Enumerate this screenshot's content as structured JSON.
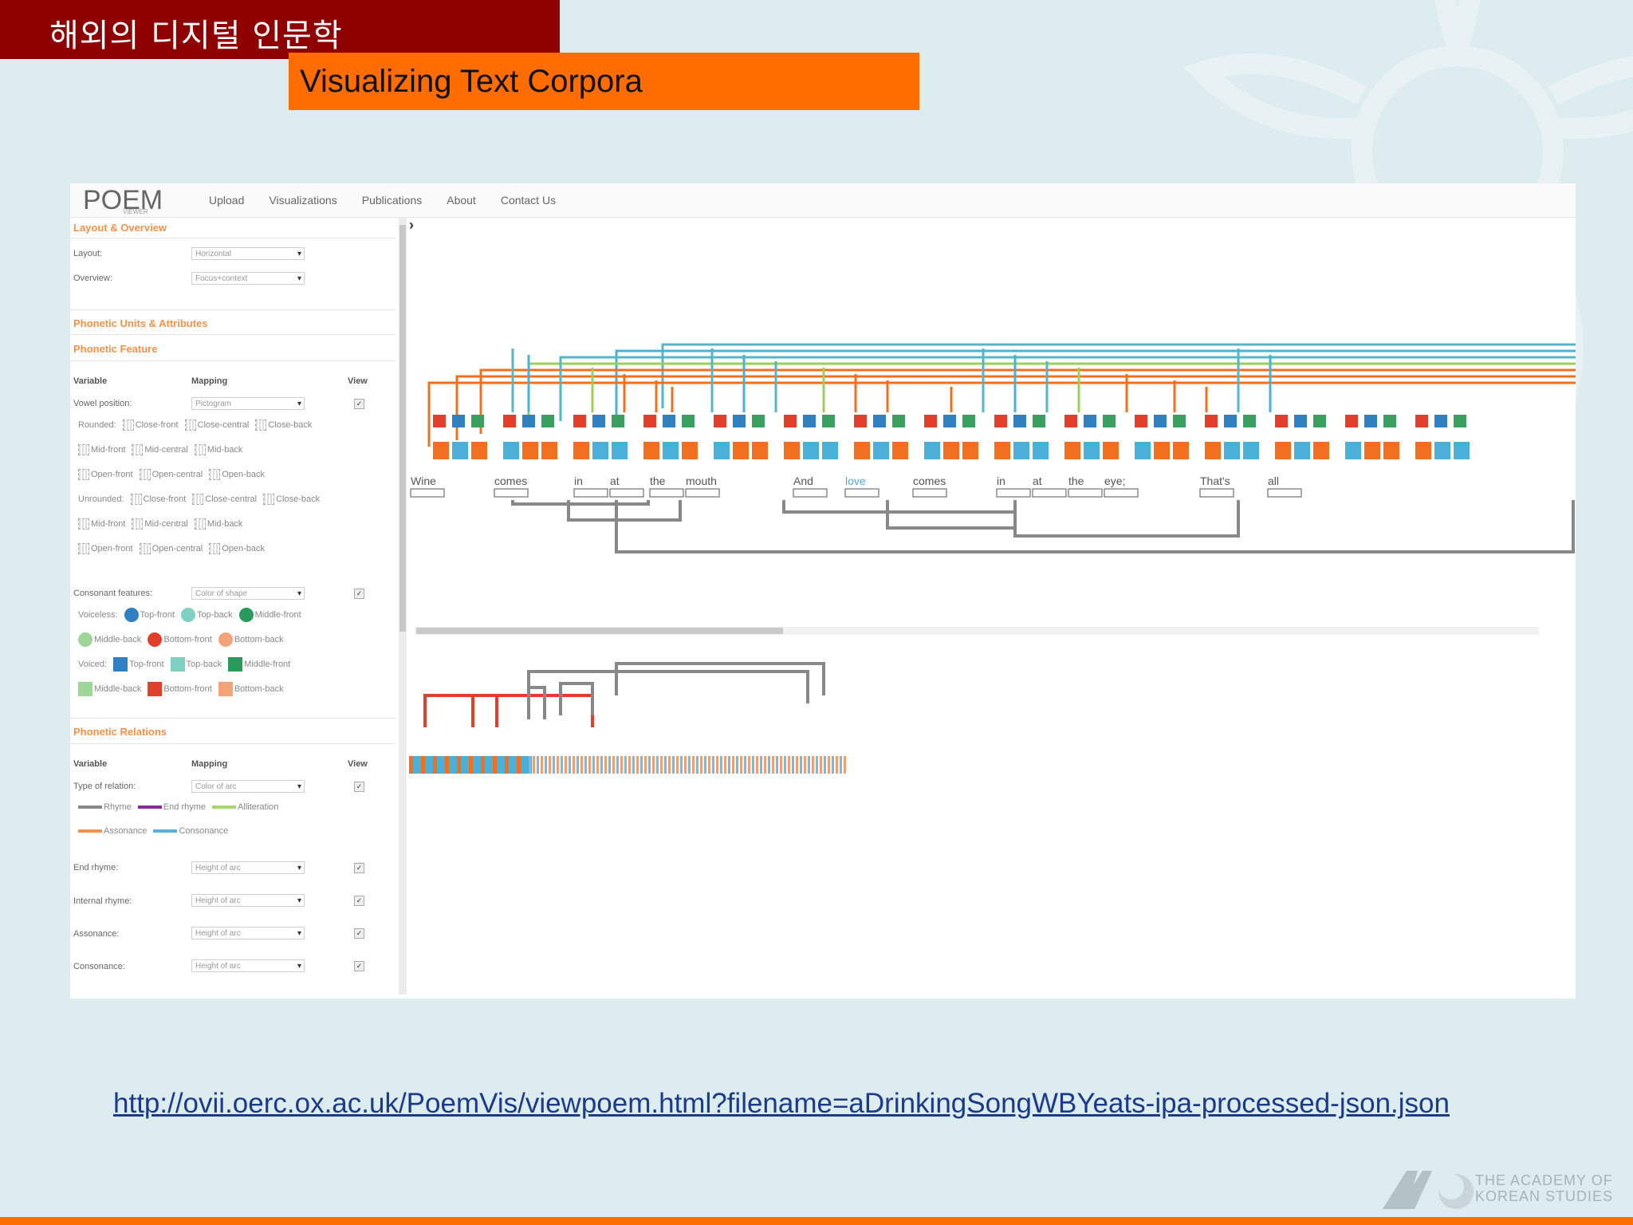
{
  "slide": {
    "title": "해외의 디지털 인문학",
    "subtitle": "Visualizing Text Corpora",
    "url": "http://ovii.oerc.ox.ac.uk/PoemVis/viewpoem.html?filename=aDrinkingSongWBYeats-ipa-processed-json.json",
    "footer_logo_line1": "THE ACADEMY OF",
    "footer_logo_line2": "KOREAN STUDIES"
  },
  "app": {
    "logo": "POEM",
    "logo_sub": "VIEWER",
    "nav": [
      "Upload",
      "Visualizations",
      "Publications",
      "About",
      "Contact Us"
    ]
  },
  "panel": {
    "layout_section": "Layout & Overview",
    "layout_label": "Layout:",
    "layout_value": "Horizontal",
    "overview_label": "Overview:",
    "overview_value": "Focus+context",
    "units_section": "Phonetic Units & Attributes",
    "feature_section": "Phonetic Feature",
    "col_variable": "Variable",
    "col_mapping": "Mapping",
    "col_view": "View",
    "vowel_label": "Vowel position:",
    "vowel_value": "Pictogram",
    "rounded_label": "Rounded:",
    "unrounded_label": "Unrounded:",
    "vowel_positions": [
      "Close-front",
      "Close-central",
      "Close-back",
      "Mid-front",
      "Mid-central",
      "Mid-back",
      "Open-front",
      "Open-central",
      "Open-back"
    ],
    "consonant_label": "Consonant features:",
    "consonant_value": "Color of shape",
    "voiceless_label": "Voiceless:",
    "voiced_label": "Voiced:",
    "consonant_positions": [
      "Top-front",
      "Top-back",
      "Middle-front",
      "Middle-back",
      "Bottom-front",
      "Bottom-back"
    ],
    "voiceless_colors": [
      "#2f80c0",
      "#7fd0c0",
      "#2a9a5a",
      "#9ed69a",
      "#e0402a",
      "#f4a27a"
    ],
    "voiced_colors": [
      "#2f80c0",
      "#7fd0c0",
      "#2a9a5a",
      "#9ed69a",
      "#e0402a",
      "#f4a27a"
    ],
    "relations_section": "Phonetic Relations",
    "relation_type_label": "Type of relation:",
    "relation_type_value": "Color of arc",
    "relations": [
      {
        "name": "Rhyme",
        "color": "#888888"
      },
      {
        "name": "End rhyme",
        "color": "#8a2a9a"
      },
      {
        "name": "Alliteration",
        "color": "#a8d86a"
      },
      {
        "name": "Assonance",
        "color": "#f4924a"
      },
      {
        "name": "Consonance",
        "color": "#5ab0d8"
      }
    ],
    "end_rhyme_label": "End rhyme:",
    "internal_rhyme_label": "Internal rhyme:",
    "assonance_label": "Assonance:",
    "consonance_label": "Consonance:",
    "height_value": "Height of arc",
    "check": "✓"
  },
  "viz": {
    "collapse_glyph": "›",
    "words": [
      "Wine",
      "comes",
      "in",
      "at",
      "the",
      "mouth",
      "And",
      "love",
      "comes",
      "in",
      "at",
      "the",
      "eye;",
      "That's",
      "all"
    ],
    "colors": {
      "orange": "#f07020",
      "blue": "#4ab0d8",
      "grey": "#888888",
      "teal": "#56b6c8",
      "green": "#9ccf5a"
    }
  }
}
